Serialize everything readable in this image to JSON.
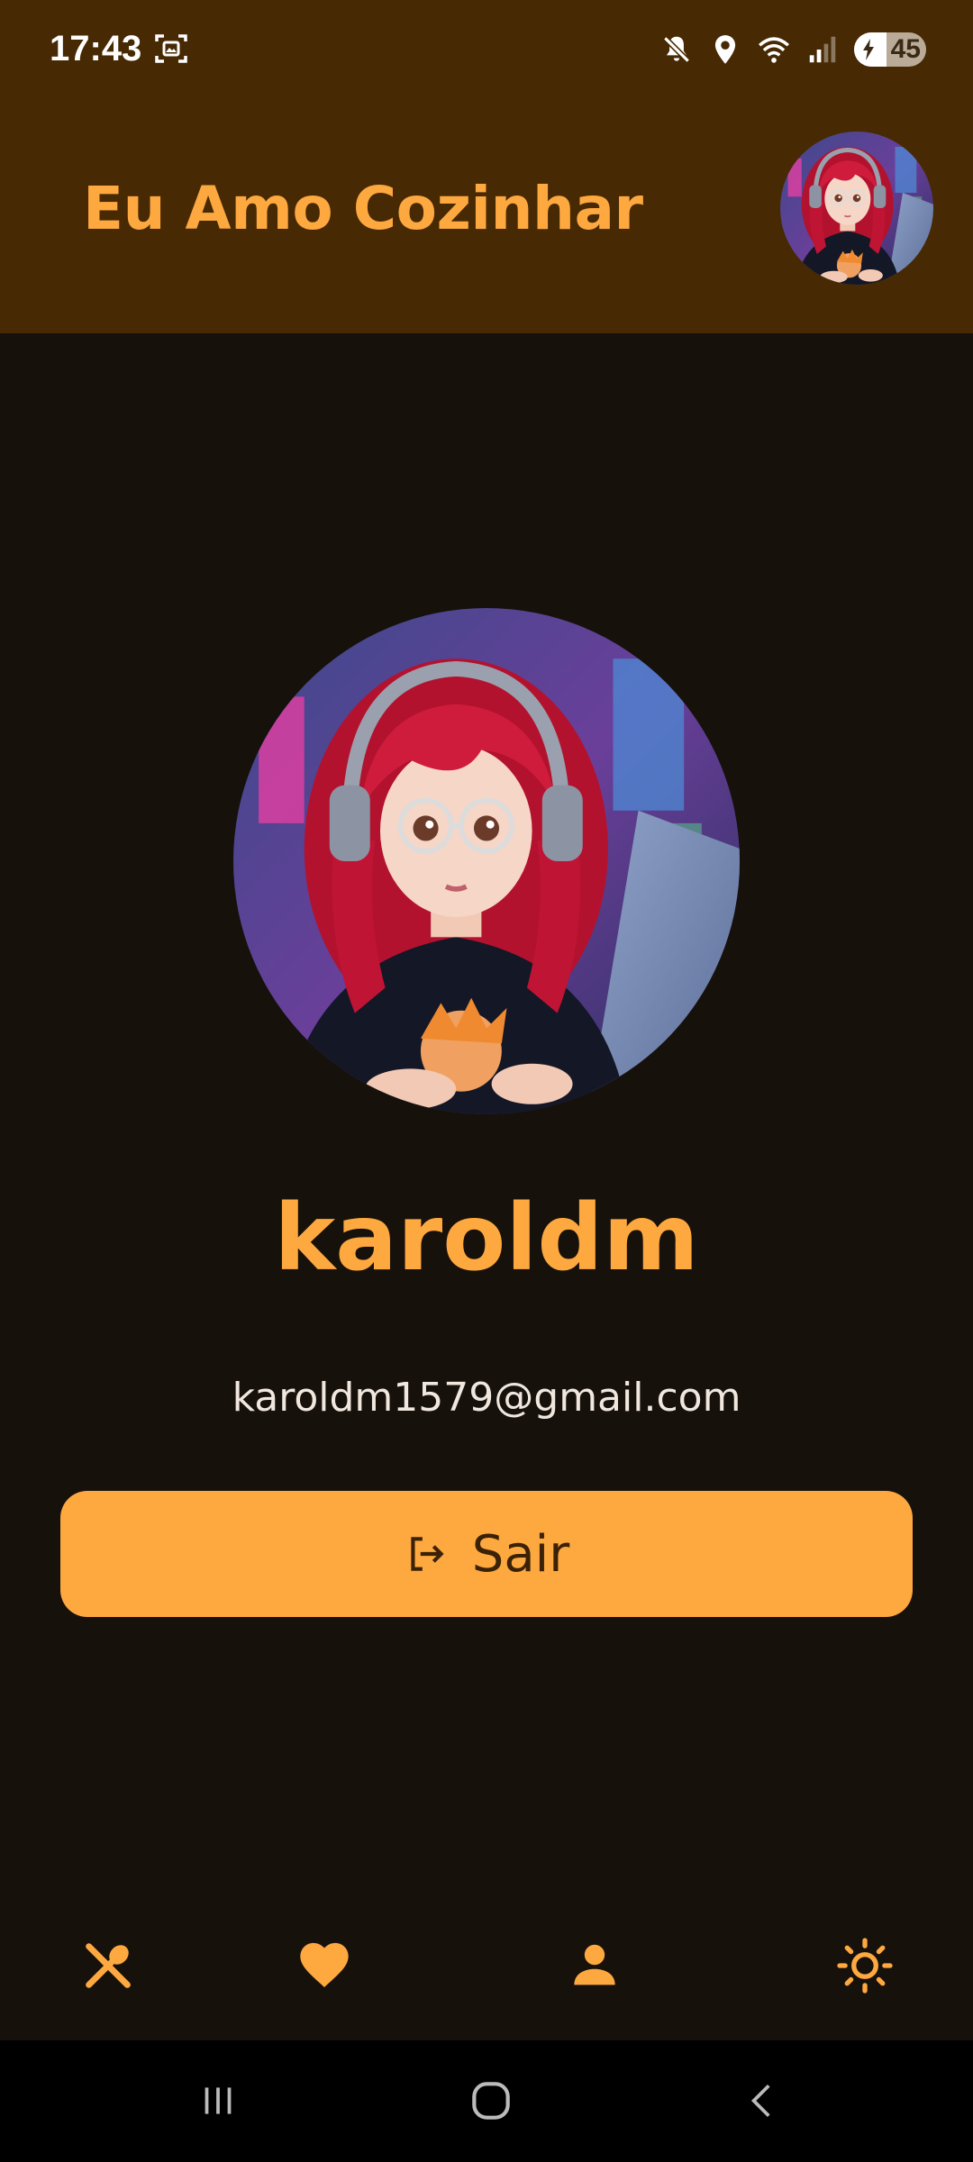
{
  "status_bar": {
    "time": "17:43",
    "battery_level": "45",
    "battery_fraction": 0.45,
    "icons": [
      "screenshot-icon",
      "mute-icon",
      "location-icon",
      "wifi-icon",
      "signal-icon",
      "battery-charging-icon"
    ]
  },
  "header": {
    "title": "Eu Amo Cozinhar",
    "avatar_icon": "user-avatar"
  },
  "profile": {
    "username": "karoldm",
    "email": "karoldm1579@gmail.com",
    "logout_label": "Sair",
    "logout_icon": "logout-icon"
  },
  "bottom_nav": {
    "items": [
      {
        "icon": "utensils-icon"
      },
      {
        "icon": "heart-icon"
      },
      {
        "icon": "person-icon"
      },
      {
        "icon": "sun-icon"
      }
    ]
  },
  "system_nav": {
    "items": [
      "recent-apps-icon",
      "home-icon",
      "back-icon"
    ]
  },
  "colors": {
    "accent": "#fea840",
    "header_bg": "#472903",
    "page_bg": "#17110c",
    "button_text": "#3b2206",
    "email_text": "#f0e8df"
  }
}
